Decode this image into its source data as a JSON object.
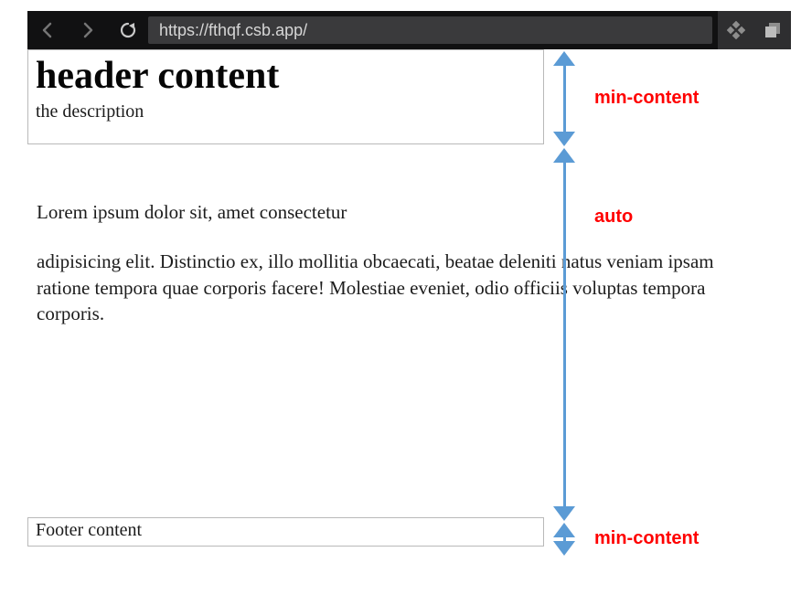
{
  "browser": {
    "url": "https://fthqf.csb.app/"
  },
  "header": {
    "title": "header content",
    "description": "the description"
  },
  "body": {
    "p1": "Lorem ipsum dolor sit, amet consectetur",
    "p2": "adipisicing elit. Distinctio ex, illo mollitia obcaecati, beatae deleniti natus veniam ipsam ratione tempora quae corporis facere! Molestiae eveniet, odio officiis voluptas tempora corporis."
  },
  "footer": {
    "text": "Footer content"
  },
  "labels": {
    "header": "min-content",
    "body": "auto",
    "footer": "min-content"
  }
}
